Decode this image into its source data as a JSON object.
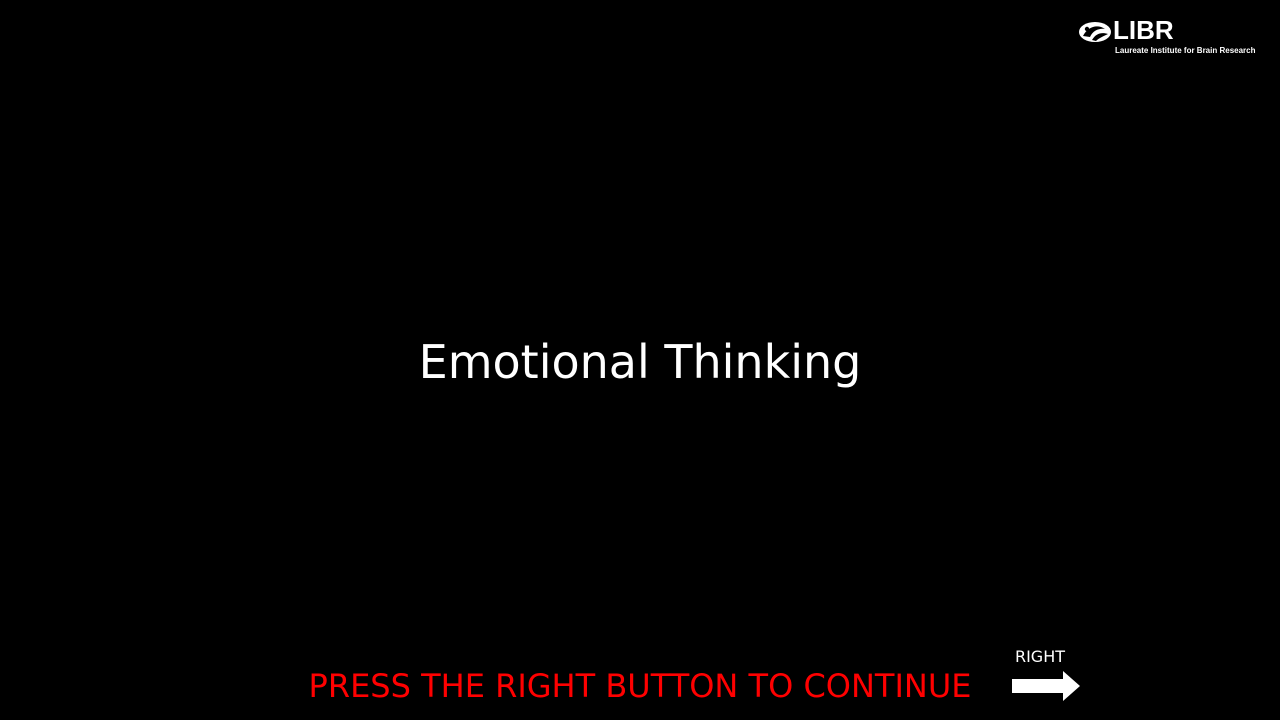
{
  "logo": {
    "wordmark": "LIBR",
    "subtitle": "Laureate Institute for Brain Research",
    "icon": "brain-swirl-icon"
  },
  "slide": {
    "title": "Emotional Thinking"
  },
  "instructions": {
    "continue_text": "PRESS THE RIGHT BUTTON TO CONTINUE",
    "button_label": "RIGHT",
    "arrow_icon": "right-arrow-icon"
  },
  "colors": {
    "background": "#000000",
    "title": "#ffffff",
    "instruction": "#ff0000",
    "arrow": "#ffffff"
  }
}
